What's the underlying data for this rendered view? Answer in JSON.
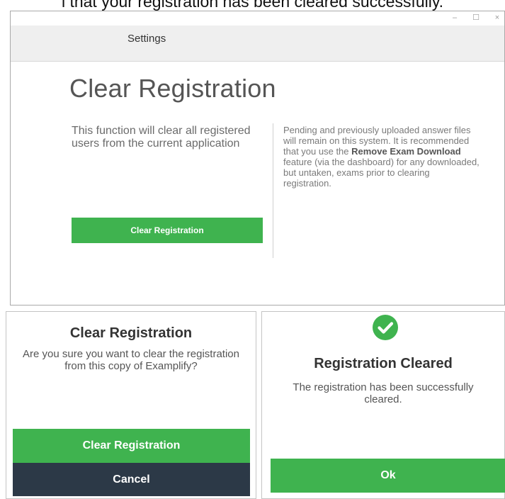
{
  "caption": "l that your registration has been cleared successfully.",
  "window": {
    "controls": {
      "minimize": "–",
      "maximize": "☐",
      "close": "×"
    },
    "tab": "Settings",
    "title": "Clear Registration",
    "left_description": "This function will clear all registered users from the current application",
    "right_description": {
      "part1": "Pending and previously uploaded answer files will remain on this system. It is recommended that you use the ",
      "bold": "Remove Exam Download",
      "part2": " feature (via the dashboard) for any downloaded, but untaken, exams prior to clearing registration."
    },
    "button_label": "Clear Registration"
  },
  "confirm_dialog": {
    "title": "Clear Registration",
    "message": "Are you sure you want to clear the registration from this copy of Examplify?",
    "confirm_label": "Clear Registration",
    "cancel_label": "Cancel"
  },
  "success_dialog": {
    "icon": "check-circle-icon",
    "title": "Registration Cleared",
    "message": "The registration has been successfully cleared.",
    "ok_label": "Ok"
  },
  "colors": {
    "green": "#3fb34f",
    "dark": "#2c3947"
  }
}
